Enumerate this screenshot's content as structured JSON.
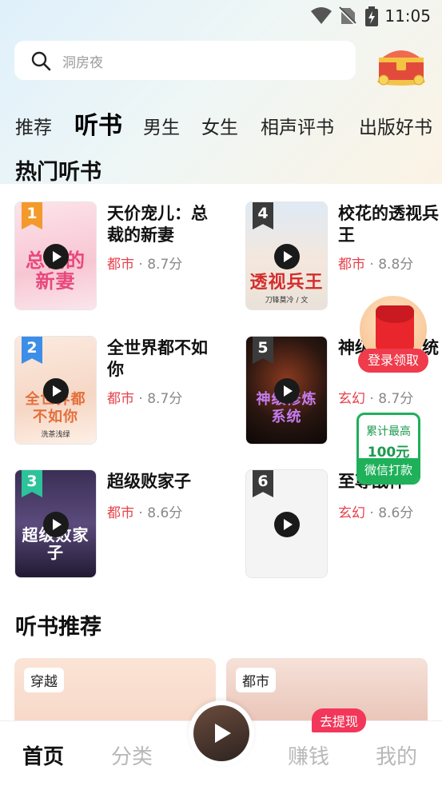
{
  "status_bar": {
    "time": "11:05",
    "icons": [
      "wifi-icon",
      "no-sim-icon",
      "battery-charging-icon"
    ]
  },
  "search": {
    "placeholder": "洞房夜",
    "icon": "search-icon"
  },
  "header_icon": "treasure-chest-icon",
  "tabs": [
    {
      "label": "推荐",
      "active": false
    },
    {
      "label": "听书",
      "active": true
    },
    {
      "label": "男生",
      "active": false
    },
    {
      "label": "女生",
      "active": false
    },
    {
      "label": "相声评书",
      "active": false
    },
    {
      "label": "出版好书",
      "active": false
    }
  ],
  "hot_section": {
    "title": "热门听书",
    "books": [
      {
        "rank": "1",
        "title": "天价宠儿：总裁的新妻",
        "genre": "都市",
        "sep": "·",
        "score": "8.7分",
        "cover_title": "总裁的新妻",
        "cover_author": "",
        "rank_color": "#f39a2a"
      },
      {
        "rank": "4",
        "title": "校花的透视兵王",
        "genre": "都市",
        "sep": "·",
        "score": "8.8分",
        "cover_title": "透视兵王",
        "cover_author": "刀锋莫冷 / 文",
        "rank_color": "#3b3b3b"
      },
      {
        "rank": "2",
        "title": "全世界都不如你",
        "genre": "都市",
        "sep": "·",
        "score": "8.7分",
        "cover_title": "全世界都不如你",
        "cover_author": "洗茶浅绿",
        "rank_color": "#3d8ee8"
      },
      {
        "rank": "5",
        "title": "神级修炼系统",
        "genre": "玄幻",
        "sep": "·",
        "score": "8.7分",
        "cover_title": "神级修炼系统",
        "cover_author": "",
        "rank_color": "#3b3b3b"
      },
      {
        "rank": "3",
        "title": "超级败家子",
        "genre": "都市",
        "sep": "·",
        "score": "8.6分",
        "cover_title": "超级败家子",
        "cover_author": "",
        "rank_color": "#2cc29a"
      },
      {
        "rank": "6",
        "title": "至尊战神",
        "genre": "玄幻",
        "sep": "·",
        "score": "8.6分",
        "cover_title": "",
        "cover_author": "",
        "rank_color": "#3b3b3b"
      }
    ]
  },
  "recommend_section": {
    "title": "听书推荐",
    "cards": [
      {
        "tag": "穿越"
      },
      {
        "tag": "都市"
      }
    ]
  },
  "floating": {
    "redpacket_label": "登录领取",
    "wechat_line1": "累计最高",
    "wechat_line2": "100元",
    "wechat_button": "微信打款"
  },
  "bottom_nav": {
    "items": [
      {
        "label": "首页",
        "active": true
      },
      {
        "label": "分类",
        "active": false
      },
      {
        "label": "赚钱",
        "active": false
      },
      {
        "label": "我的",
        "active": false
      }
    ],
    "badge": "去提现"
  },
  "colors": {
    "accent_red": "#e6434c",
    "wechat_green": "#1fb05a",
    "badge_pink": "#f2375a"
  }
}
